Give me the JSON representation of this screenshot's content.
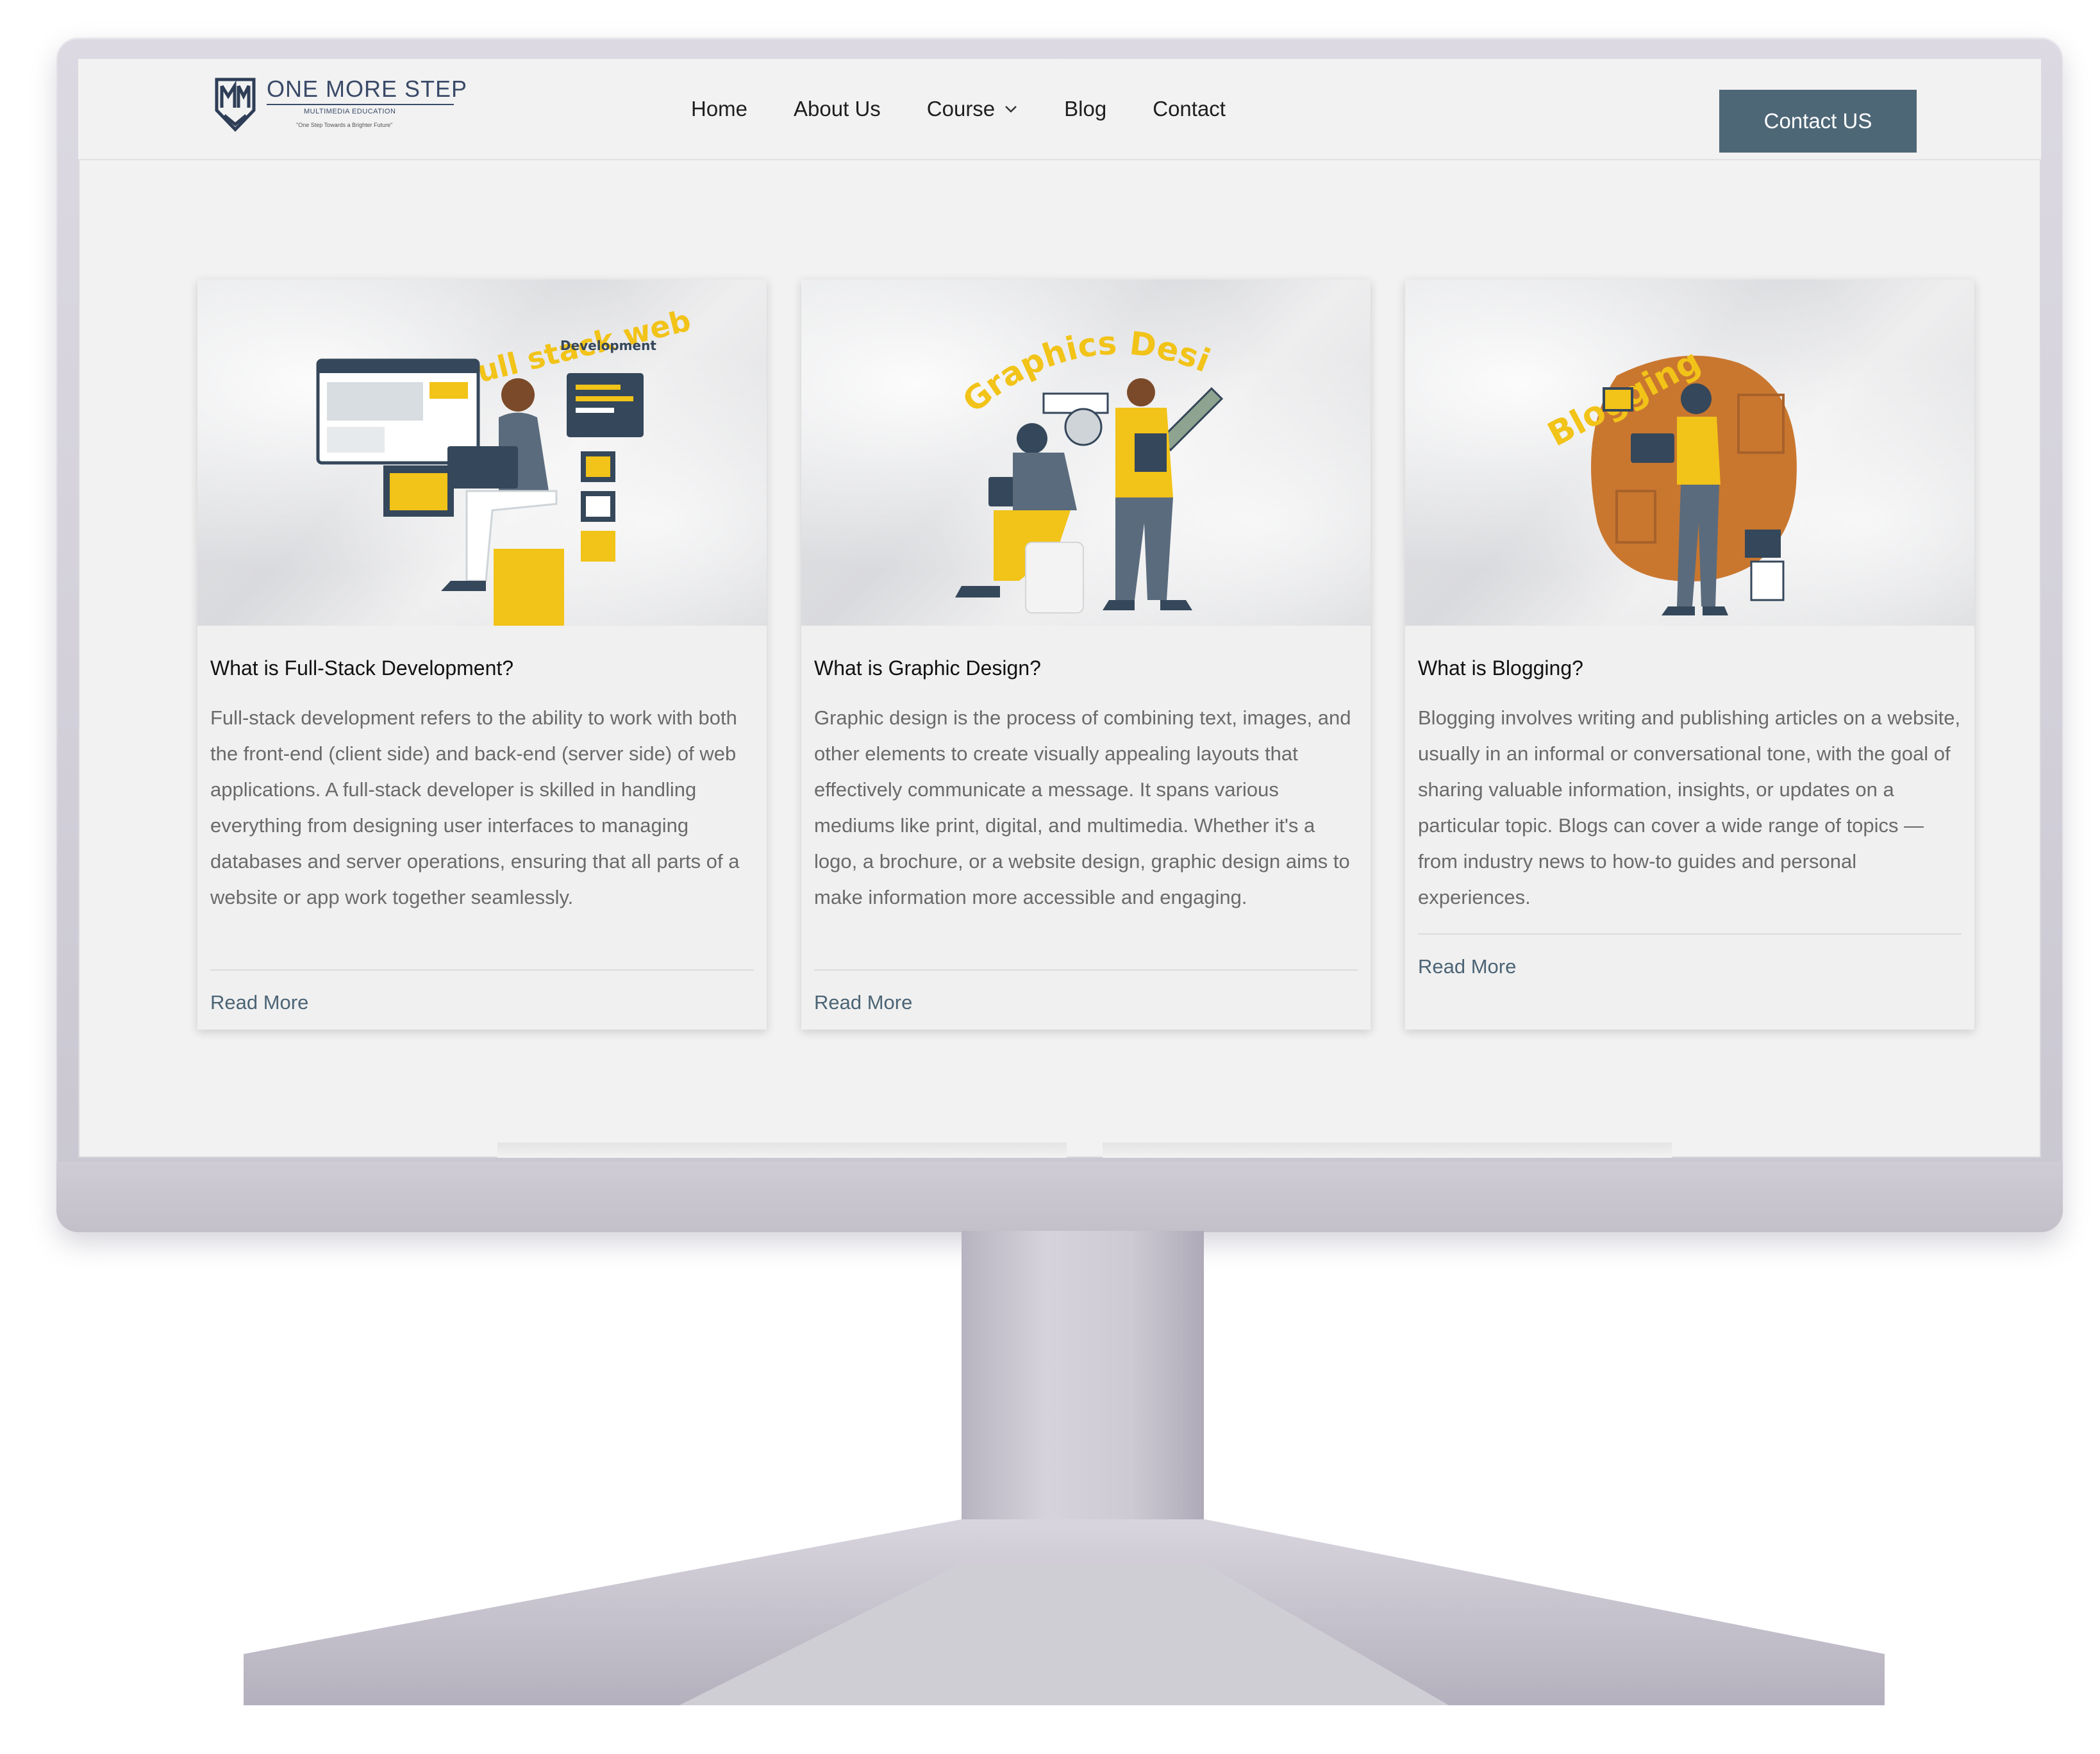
{
  "brand": {
    "name": "ONE MORE STEP",
    "subtitle": "MULTIMEDIA EDUCATION",
    "tagline": "\"One Step Towards a Brighter Future\"",
    "monogram": "OMS",
    "color": "#3a4a68"
  },
  "nav": {
    "items": [
      {
        "label": "Home"
      },
      {
        "label": "About Us"
      },
      {
        "label": "Course",
        "has_dropdown": true,
        "icon": "chevron-down-icon"
      },
      {
        "label": "Blog"
      },
      {
        "label": "Contact"
      }
    ],
    "cta_label": "Contact US",
    "cta_color": "#4e6777"
  },
  "cards": [
    {
      "image_caption": "full stack web",
      "image_subcaption": "Development",
      "title": "What is Full-Stack Development?",
      "text": "Full-stack development refers to the ability to work with both the front-end (client side) and back-end (server side) of web applications. A full-stack developer is skilled in handling everything from designing user interfaces to managing databases and server operations, ensuring that all parts of a website or app work together seamlessly.",
      "link_label": "Read More"
    },
    {
      "image_caption": "Graphics Design",
      "title": "What is Graphic Design?",
      "text": "Graphic design is the process of combining text, images, and other elements to create visually appealing layouts that effectively communicate a message. It spans various mediums like print, digital, and multimedia. Whether it's a logo, a brochure, or a website design, graphic design aims to make information more accessible and engaging.",
      "link_label": "Read More"
    },
    {
      "image_caption": "Blogging",
      "title": "What is Blogging?",
      "text": "Blogging involves writing and publishing articles on a website, usually in an informal or conversational tone, with the goal of sharing valuable information, insights, or updates on a particular topic. Blogs can cover a wide range of topics — from industry news to how-to guides and personal experiences.",
      "link_label": "Read More"
    }
  ],
  "colors": {
    "accent_yellow": "#f2c318",
    "navy": "#35475a",
    "orange_blob": "#c9772f",
    "link": "#4b6475"
  }
}
